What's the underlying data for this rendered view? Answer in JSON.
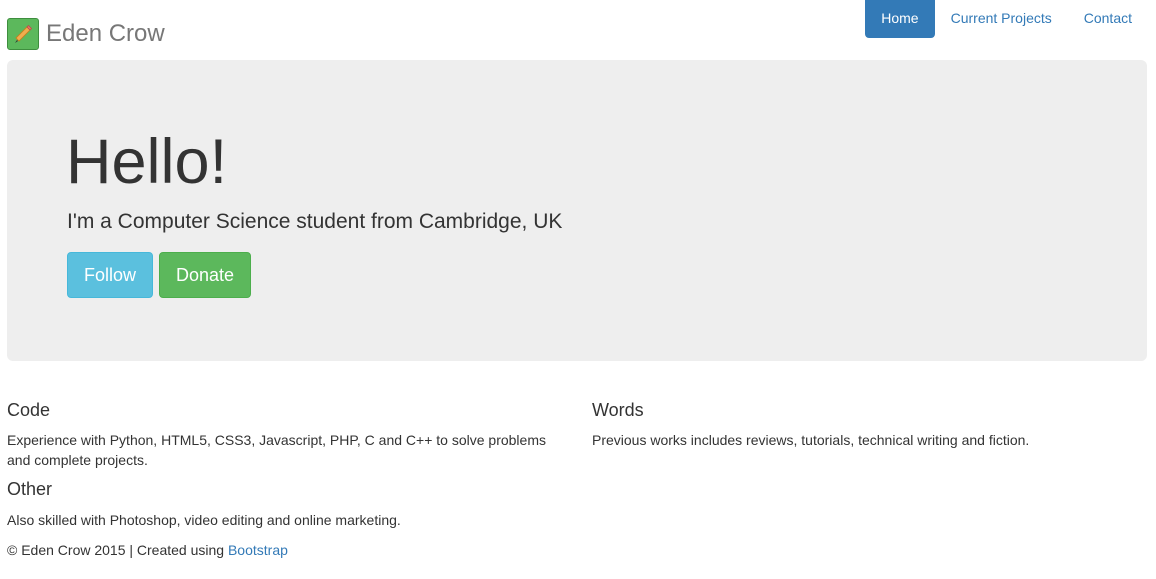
{
  "brand": {
    "name": "Eden Crow",
    "icon": "pencil-icon"
  },
  "nav": {
    "items": [
      {
        "label": "Home",
        "active": true
      },
      {
        "label": "Current Projects",
        "active": false
      },
      {
        "label": "Contact",
        "active": false
      }
    ]
  },
  "hero": {
    "title": "Hello!",
    "subtitle": "I'm a Computer Science student from Cambridge, UK",
    "follow_label": "Follow",
    "donate_label": "Donate"
  },
  "sections": {
    "code": {
      "heading": "Code",
      "text": "Experience with Python, HTML5, CSS3, Javascript, PHP, C and C++ to solve problems and complete projects."
    },
    "words": {
      "heading": "Words",
      "text": "Previous works includes reviews, tutorials, technical writing and fiction."
    },
    "other": {
      "heading": "Other",
      "text": "Also skilled with Photoshop, video editing and online marketing."
    }
  },
  "footer": {
    "text": "© Eden Crow 2015 | Created using ",
    "link_label": "Bootstrap"
  },
  "colors": {
    "primary": "#337ab7",
    "info": "#5bc0de",
    "success": "#5cb85c",
    "jumbotron_bg": "#eeeeee"
  }
}
